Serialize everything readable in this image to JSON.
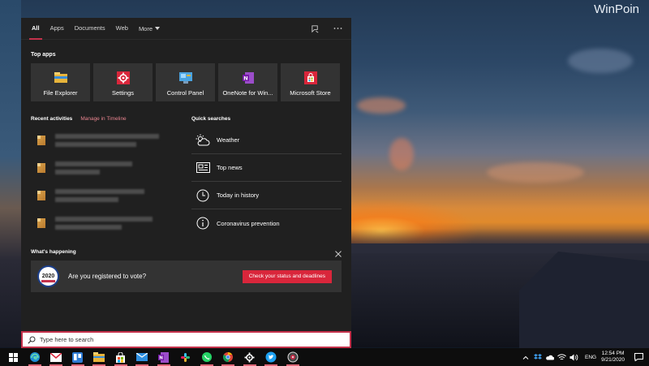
{
  "watermark": "WinPoin",
  "tabs": [
    {
      "label": "All",
      "active": true
    },
    {
      "label": "Apps"
    },
    {
      "label": "Documents"
    },
    {
      "label": "Web"
    },
    {
      "label": "More"
    }
  ],
  "tools": [
    "feedback-icon",
    "more-options-icon"
  ],
  "top_apps": {
    "title": "Top apps",
    "items": [
      {
        "label": "File Explorer",
        "icon": "file-explorer-icon"
      },
      {
        "label": "Settings",
        "icon": "settings-icon"
      },
      {
        "label": "Control Panel",
        "icon": "control-panel-icon"
      },
      {
        "label": "OneNote for Win...",
        "icon": "onenote-icon"
      },
      {
        "label": "Microsoft Store",
        "icon": "store-icon"
      }
    ]
  },
  "recent": {
    "title": "Recent activities",
    "link": "Manage in Timeline",
    "count_items": 4
  },
  "quick": {
    "title": "Quick searches",
    "items": [
      {
        "label": "Weather",
        "icon": "weather-icon"
      },
      {
        "label": "Top news",
        "icon": "news-icon"
      },
      {
        "label": "Today in history",
        "icon": "clock-icon"
      },
      {
        "label": "Coronavirus prevention",
        "icon": "info-icon"
      }
    ]
  },
  "happening": {
    "title": "What's happening",
    "badge_year": "2020",
    "question": "Are you registered to vote?",
    "button": "Check your status and deadlines"
  },
  "search": {
    "placeholder": "Type here to search"
  },
  "tray": {
    "language": "ENG",
    "time": "12:54 PM",
    "date": "9/21/2020"
  },
  "colors": {
    "accent": "#c4314b",
    "panel_bg": "#202020",
    "tile_bg": "#333333",
    "vote_button": "#d9263b"
  }
}
